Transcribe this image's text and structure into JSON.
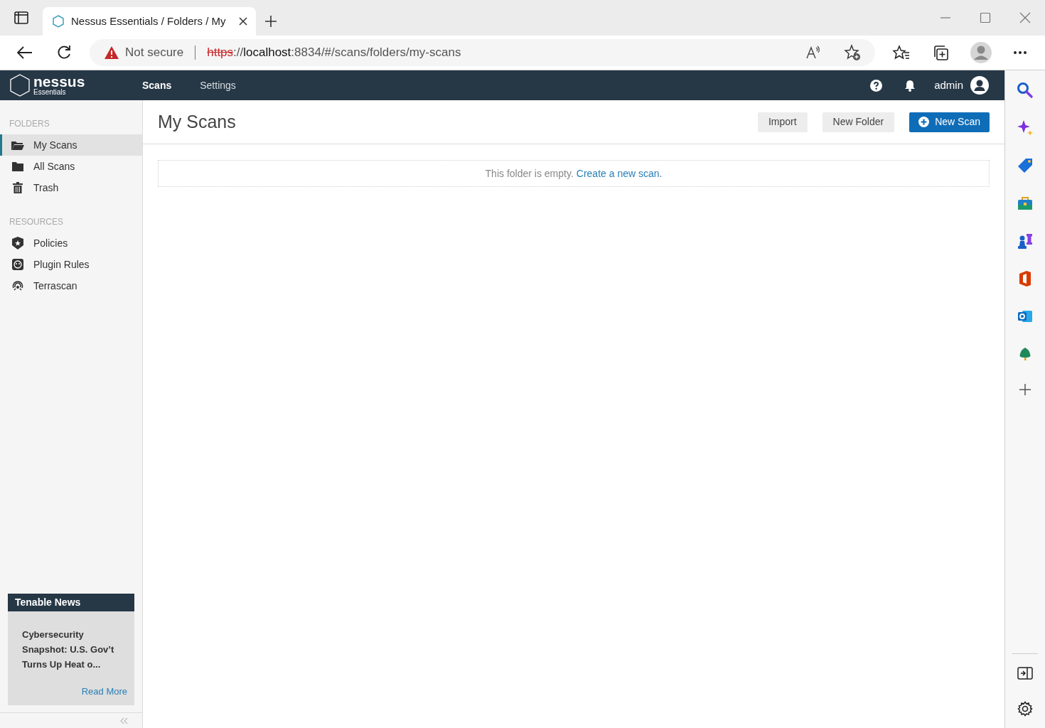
{
  "browser": {
    "tab_title": "Nessus Essentials / Folders / My",
    "security": "Not secure",
    "url": {
      "scheme": "https",
      "separator": "://",
      "host": "localhost",
      "rest": ":8834/#/scans/folders/my-scans"
    }
  },
  "app": {
    "logo": {
      "name": "nessus",
      "edition": "Essentials"
    },
    "nav": [
      {
        "label": "Scans",
        "selected": true
      },
      {
        "label": "Settings",
        "selected": false
      }
    ],
    "user": "admin"
  },
  "sidebar": {
    "sections": [
      {
        "heading": "FOLDERS",
        "items": [
          {
            "label": "My Scans",
            "selected": true
          },
          {
            "label": "All Scans",
            "selected": false
          },
          {
            "label": "Trash",
            "selected": false
          }
        ]
      },
      {
        "heading": "RESOURCES",
        "items": [
          {
            "label": "Policies",
            "selected": false
          },
          {
            "label": "Plugin Rules",
            "selected": false
          },
          {
            "label": "Terrascan",
            "selected": false
          }
        ]
      }
    ],
    "news": {
      "heading": "Tenable News",
      "headline": "Cybersecurity Snapshot: U.S. Gov’t Turns Up Heat o...",
      "link": "Read More"
    }
  },
  "page": {
    "title": "My Scans",
    "buttons": [
      {
        "label": "Import",
        "kind": "secondary"
      },
      {
        "label": "New Folder",
        "kind": "secondary"
      },
      {
        "label": "New Scan",
        "kind": "primary"
      }
    ],
    "empty_message": {
      "text": "This folder is empty.",
      "link": "Create a new scan."
    }
  }
}
